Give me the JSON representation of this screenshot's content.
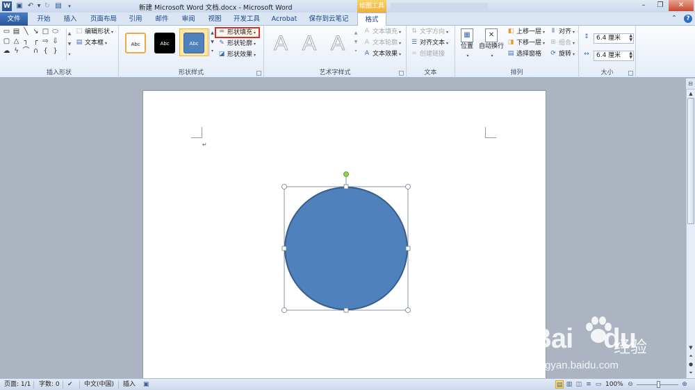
{
  "window": {
    "title": "新建 Microsoft Word 文档.docx - Microsoft Word",
    "context_tab_group": "绘图工具",
    "app_icon": "W",
    "controls": {
      "minimize": "–",
      "restore": "❐",
      "close": "✕"
    }
  },
  "tabs": [
    "文件",
    "开始",
    "插入",
    "页面布局",
    "引用",
    "邮件",
    "审阅",
    "视图",
    "开发工具",
    "Acrobat",
    "保存到云笔记",
    "格式"
  ],
  "active_tab": "格式",
  "ribbon": {
    "insert_shapes": {
      "label": "插入形状",
      "edit_shape": "编辑形状",
      "text_box": "文本框"
    },
    "shape_styles": {
      "label": "形状样式",
      "swatches": [
        "Abc",
        "Abc",
        "Abc"
      ],
      "shape_fill": "形状填充",
      "shape_outline": "形状轮廓",
      "shape_effects": "形状效果"
    },
    "wordart_styles": {
      "label": "艺术字样式",
      "letters": [
        "A",
        "A",
        "A"
      ],
      "text_fill": "文本填充",
      "text_outline": "文本轮廓",
      "text_effects": "文本效果"
    },
    "text": {
      "label": "文本",
      "text_direction": "文字方向",
      "align_text": "对齐文本",
      "create_link": "创建链接"
    },
    "arrange": {
      "label": "排列",
      "position": "位置",
      "wrap_text": "自动换行",
      "bring_forward": "上移一层",
      "send_backward": "下移一层",
      "selection_pane": "选择窗格",
      "align": "对齐",
      "group": "组合",
      "rotate": "旋转"
    },
    "size": {
      "label": "大小",
      "height": "6.4 厘米",
      "width": "6.4 厘米"
    }
  },
  "document": {
    "paragraph_mark": "↵",
    "shape": {
      "type": "circle",
      "fill": "#4f81bd",
      "outline": "#385d8a",
      "selected": true
    }
  },
  "statusbar": {
    "page": "页面: 1/1",
    "words": "字数: 0",
    "language": "中文(中国)",
    "mode": "插入",
    "zoom": "100%"
  },
  "watermark": {
    "brand": "Bai",
    "brand_suffix": "du",
    "cn": "经验",
    "url": "jingyan.baidu.com"
  },
  "colors": {
    "accent": "#2b5797",
    "shape_fill": "#4f81bd",
    "highlight_box": "#d32f2f"
  }
}
